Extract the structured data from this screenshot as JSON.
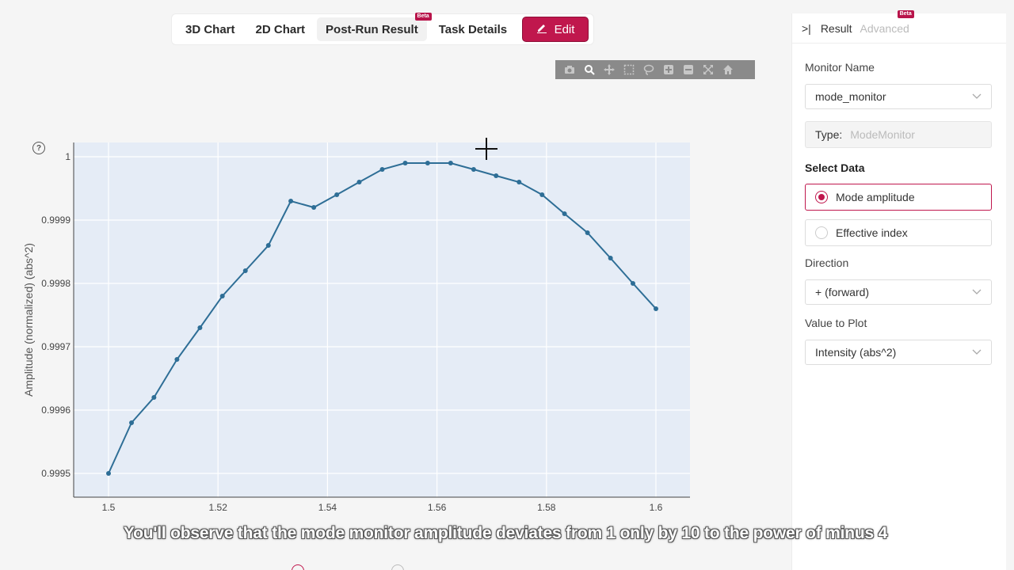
{
  "tabs": [
    {
      "label": "3D Chart",
      "active": false,
      "beta": false
    },
    {
      "label": "2D Chart",
      "active": false,
      "beta": false
    },
    {
      "label": "Post-Run Result",
      "active": true,
      "beta": true
    },
    {
      "label": "Task Details",
      "active": false,
      "beta": false
    }
  ],
  "beta_badge": "Beta",
  "edit_button": {
    "label": "Edit",
    "color": "#c0174d"
  },
  "modebar_icons": [
    "camera-icon",
    "zoom-icon",
    "pan-icon",
    "box-select-icon",
    "lasso-icon",
    "zoom-in-icon",
    "zoom-out-icon",
    "autoscale-icon",
    "home-icon"
  ],
  "chart_data": {
    "type": "line",
    "ylabel": "Amplitude (normalized) (abs^2)",
    "xlabel": "",
    "xlim": [
      1.5,
      1.6
    ],
    "ylim": [
      0.99945,
      1.00002
    ],
    "xticks": [
      "1.5",
      "1.52",
      "1.54",
      "1.56",
      "1.58",
      "1.6"
    ],
    "yticks": [
      "0.9995",
      "0.9996",
      "0.9997",
      "0.9998",
      "0.9999",
      "1"
    ],
    "grid": true,
    "line_color": "#2e6e96",
    "series": [
      {
        "x": [
          1.5,
          1.5042,
          1.5083,
          1.5125,
          1.5167,
          1.5208,
          1.525,
          1.5292,
          1.5333,
          1.5375,
          1.5417,
          1.5458,
          1.55,
          1.5542,
          1.5583,
          1.5625,
          1.5667,
          1.5708,
          1.575,
          1.5792,
          1.5833,
          1.5875,
          1.5917,
          1.5958,
          1.6
        ],
        "y": [
          0.9995,
          0.99958,
          0.99962,
          0.99968,
          0.99973,
          0.99978,
          0.99982,
          0.99986,
          0.99993,
          0.99992,
          0.99994,
          0.99996,
          0.99998,
          0.99999,
          0.99999,
          0.99999,
          0.99998,
          0.99997,
          0.99996,
          0.99994,
          0.99991,
          0.99988,
          0.99984,
          0.9998,
          0.99976
        ]
      }
    ]
  },
  "panel": {
    "tab_result": "Result",
    "tab_advanced": "Advanced",
    "monitor_name_label": "Monitor Name",
    "monitor_name_value": "mode_monitor",
    "type_label": "Type:",
    "type_value": "ModeMonitor",
    "select_data_label": "Select Data",
    "options": [
      "Mode amplitude",
      "Effective index"
    ],
    "direction_label": "Direction",
    "direction_value": "+ (forward)",
    "value_to_plot_label": "Value to Plot",
    "value_to_plot_value": "Intensity (abs^2)"
  },
  "caption": "You'll observe that the mode monitor amplitude deviates from 1 only by 10 to the power of minus 4"
}
